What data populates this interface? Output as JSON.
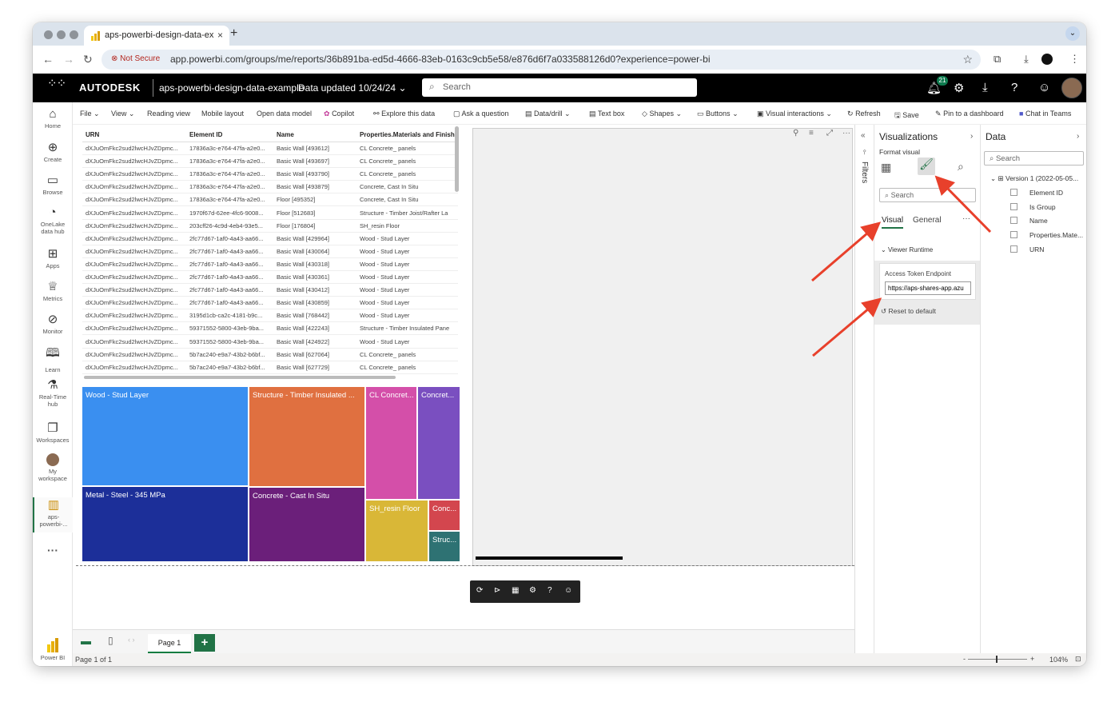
{
  "browser": {
    "tab_title": "aps-powerbi-design-data-ex",
    "security_label": "Not Secure",
    "url": "app.powerbi.com/groups/me/reports/36b891ba-ed5d-4666-83eb-0163c9cb5e58/e876d6f7a033588126d0?experience=power-bi"
  },
  "header": {
    "logo": "AUTODESK",
    "report_name": "aps-powerbi-design-data-example",
    "data_updated": "Data updated 10/24/24",
    "search_placeholder": "Search",
    "notification_count": "21"
  },
  "left_nav": [
    {
      "label": "Home",
      "icon": "home-icon"
    },
    {
      "label": "Create",
      "icon": "create-icon"
    },
    {
      "label": "Browse",
      "icon": "browse-icon"
    },
    {
      "label": "OneLake data hub",
      "icon": "onelake-icon"
    },
    {
      "label": "Apps",
      "icon": "apps-icon"
    },
    {
      "label": "Metrics",
      "icon": "metrics-icon"
    },
    {
      "label": "Monitor",
      "icon": "monitor-icon"
    },
    {
      "label": "Learn",
      "icon": "learn-icon"
    },
    {
      "label": "Real-Time hub",
      "icon": "realtime-icon"
    },
    {
      "label": "Workspaces",
      "icon": "workspaces-icon"
    },
    {
      "label": "My workspace",
      "icon": "my-workspace-icon"
    },
    {
      "label": "aps-powerbi-...",
      "icon": "report-icon"
    },
    {
      "label": "Power BI",
      "icon": "powerbi-icon"
    }
  ],
  "ribbon": [
    "File",
    "View",
    "Reading view",
    "Mobile layout",
    "Open data model",
    "Copilot",
    "Explore this data",
    "Ask a question",
    "Data/drill",
    "Text box",
    "Shapes",
    "Buttons",
    "Visual interactions",
    "Refresh",
    "Save",
    "Pin to a dashboard",
    "Chat in Teams"
  ],
  "table": {
    "columns": [
      "URN",
      "Element ID",
      "Name",
      "Properties.Materials and Finish"
    ],
    "rows": [
      [
        "dXJuOmFkc2sud2lwcHJvZDpmc...",
        "17836a3c-e764-47fa-a2e0...",
        "Basic Wall [493612]",
        "CL Concrete_ panels"
      ],
      [
        "dXJuOmFkc2sud2lwcHJvZDpmc...",
        "17836a3c-e764-47fa-a2e0...",
        "Basic Wall [493697]",
        "CL Concrete_ panels"
      ],
      [
        "dXJuOmFkc2sud2lwcHJvZDpmc...",
        "17836a3c-e764-47fa-a2e0...",
        "Basic Wall [493790]",
        "CL Concrete_ panels"
      ],
      [
        "dXJuOmFkc2sud2lwcHJvZDpmc...",
        "17836a3c-e764-47fa-a2e0...",
        "Basic Wall [493879]",
        "Concrete, Cast In Situ"
      ],
      [
        "dXJuOmFkc2sud2lwcHJvZDpmc...",
        "17836a3c-e764-47fa-a2e0...",
        "Floor [495352]",
        "Concrete, Cast In Situ"
      ],
      [
        "dXJuOmFkc2sud2lwcHJvZDpmc...",
        "1970f67d-62ee-4fc6-9008...",
        "Floor [512683]",
        "Structure - Timber Joist/Rafter La"
      ],
      [
        "dXJuOmFkc2sud2lwcHJvZDpmc...",
        "203cff26-4c9d-4eb4-93e5...",
        "Floor [176804]",
        "SH_resin Floor"
      ],
      [
        "dXJuOmFkc2sud2lwcHJvZDpmc...",
        "2fc77d67-1af0-4a43-aa66...",
        "Basic Wall [429964]",
        "Wood - Stud Layer"
      ],
      [
        "dXJuOmFkc2sud2lwcHJvZDpmc...",
        "2fc77d67-1af0-4a43-aa66...",
        "Basic Wall [430064]",
        "Wood - Stud Layer"
      ],
      [
        "dXJuOmFkc2sud2lwcHJvZDpmc...",
        "2fc77d67-1af0-4a43-aa66...",
        "Basic Wall [430318]",
        "Wood - Stud Layer"
      ],
      [
        "dXJuOmFkc2sud2lwcHJvZDpmc...",
        "2fc77d67-1af0-4a43-aa66...",
        "Basic Wall [430361]",
        "Wood - Stud Layer"
      ],
      [
        "dXJuOmFkc2sud2lwcHJvZDpmc...",
        "2fc77d67-1af0-4a43-aa66...",
        "Basic Wall [430412]",
        "Wood - Stud Layer"
      ],
      [
        "dXJuOmFkc2sud2lwcHJvZDpmc...",
        "2fc77d67-1af0-4a43-aa66...",
        "Basic Wall [430859]",
        "Wood - Stud Layer"
      ],
      [
        "dXJuOmFkc2sud2lwcHJvZDpmc...",
        "3195d1cb-ca2c-4181-b9c...",
        "Basic Wall [768442]",
        "Wood - Stud Layer"
      ],
      [
        "dXJuOmFkc2sud2lwcHJvZDpmc...",
        "59371552-5800-43eb-9ba...",
        "Basic Wall [422243]",
        "Structure - Timber Insulated Pane"
      ],
      [
        "dXJuOmFkc2sud2lwcHJvZDpmc...",
        "59371552-5800-43eb-9ba...",
        "Basic Wall [424922]",
        "Wood - Stud Layer"
      ],
      [
        "dXJuOmFkc2sud2lwcHJvZDpmc...",
        "5b7ac240-e9a7-43b2-b6bf...",
        "Basic Wall [627064]",
        "CL Concrete_ panels"
      ],
      [
        "dXJuOmFkc2sud2lwcHJvZDpmc...",
        "5b7ac240-e9a7-43b2-b6bf...",
        "Basic Wall [627729]",
        "CL Concrete_ panels"
      ]
    ]
  },
  "treemap": [
    {
      "label": "Wood - Stud Layer",
      "color": "#3a8ff0"
    },
    {
      "label": "Structure - Timber Insulated ...",
      "color": "#e07040"
    },
    {
      "label": "CL Concret...",
      "color": "#d44fa9"
    },
    {
      "label": "Concret...",
      "color": "#7a4fc0"
    },
    {
      "label": "Metal - Steel - 345 MPa",
      "color": "#1c2f99"
    },
    {
      "label": "Concrete - Cast In Situ",
      "color": "#6b1f7a"
    },
    {
      "label": "SH_resin Floor",
      "color": "#d9b737"
    },
    {
      "label": "Conc...",
      "color": "#d3464e"
    },
    {
      "label": "Struc...",
      "color": "#2e7273"
    }
  ],
  "filters_label": "Filters",
  "viz_panel": {
    "title": "Visualizations",
    "subtitle": "Format visual",
    "search_placeholder": "Search",
    "tab_visual": "Visual",
    "tab_general": "General",
    "section": "Viewer Runtime",
    "field_label": "Access Token Endpoint",
    "field_value": "https://aps-shares-app.azu",
    "reset": "Reset to default"
  },
  "data_panel": {
    "title": "Data",
    "search_placeholder": "Search",
    "table_name": "Version 1 (2022-05-05...",
    "fields": [
      "Element ID",
      "Is Group",
      "Name",
      "Properties.Mate...",
      "URN"
    ]
  },
  "pages": {
    "tab": "Page 1",
    "status": "Page 1 of 1"
  },
  "zoom": "104%"
}
